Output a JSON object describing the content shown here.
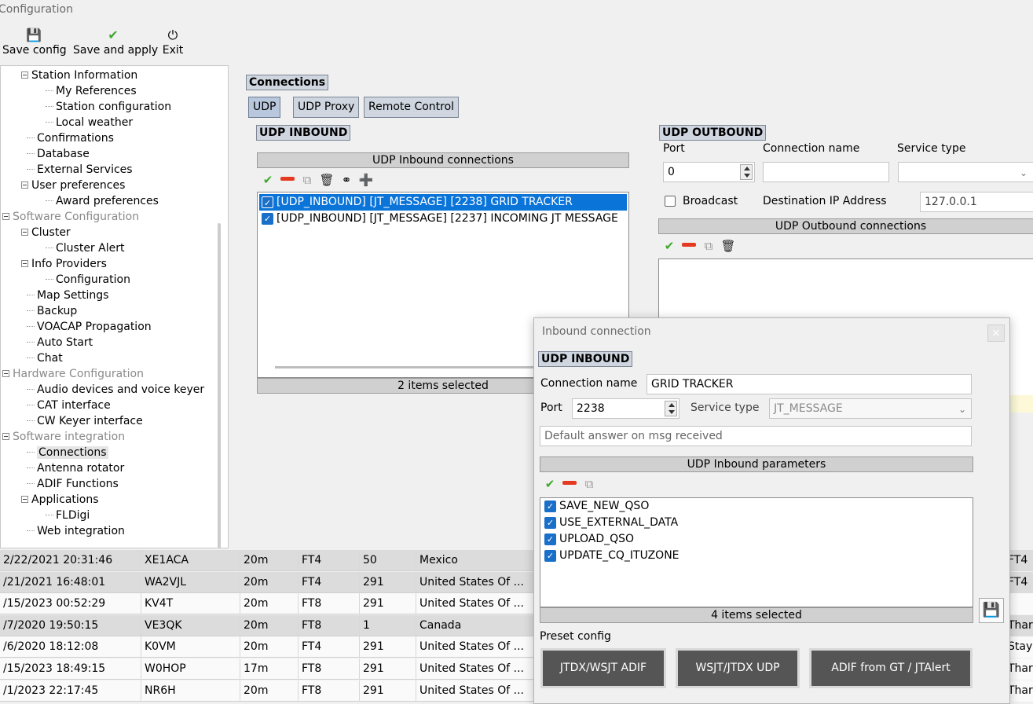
{
  "window": {
    "title": "Configuration"
  },
  "toolbar": {
    "save_config": "Save config",
    "save_and_apply": "Save and apply",
    "exit": "Exit"
  },
  "tree": {
    "station_information": "Station Information",
    "my_references": "My References",
    "station_configuration": "Station configuration",
    "local_weather": "Local weather",
    "confirmations": "Confirmations",
    "database": "Database",
    "external_services": "External Services",
    "user_preferences": "User preferences",
    "award_preferences": "Award preferences",
    "software_configuration": "Software Configuration",
    "cluster": "Cluster",
    "cluster_alert": "Cluster Alert",
    "info_providers": "Info Providers",
    "configuration": "Configuration",
    "map_settings": "Map Settings",
    "backup": "Backup",
    "voacap": "VOACAP Propagation",
    "auto_start": "Auto Start",
    "chat": "Chat",
    "hardware_configuration": "Hardware Configuration",
    "audio_devices": "Audio devices and voice keyer",
    "cat_interface": "CAT interface",
    "cw_keyer": "CW Keyer interface",
    "software_integration": "Software integration",
    "connections": "Connections",
    "antenna_rotator": "Antenna rotator",
    "adif_functions": "ADIF Functions",
    "applications": "Applications",
    "fldigi": "FLDigi",
    "web_integration": "Web integration"
  },
  "main": {
    "section_title": "Connections",
    "tabs": {
      "udp": "UDP",
      "udp_proxy": "UDP Proxy",
      "remote_control": "Remote Control"
    },
    "inbound": {
      "label": "UDP INBOUND",
      "list_header": "UDP Inbound connections",
      "rows": [
        "[UDP_INBOUND] [JT_MESSAGE] [2238] GRID TRACKER",
        "[UDP_INBOUND] [JT_MESSAGE] [2237] INCOMING JT MESSAGE"
      ],
      "footer": "2 items selected"
    },
    "outbound": {
      "label": "UDP OUTBOUND",
      "port_label": "Port",
      "port_value": "0",
      "connection_name_label": "Connection name",
      "service_type_label": "Service type",
      "broadcast_label": "Broadcast",
      "dest_ip_label": "Destination IP Address",
      "dest_ip_value": "127.0.0.1",
      "list_header": "UDP Outbound connections"
    }
  },
  "grid": {
    "rows": [
      {
        "date": "2/22/2021 20:31:46",
        "call": "XE1ACA",
        "band": "20m",
        "mode": "FT4",
        "num": "50",
        "country": "Mexico",
        "right": "FT4"
      },
      {
        "date": "/21/2021 16:48:01",
        "call": "WA2VJL",
        "band": "20m",
        "mode": "FT4",
        "num": "291",
        "country": "United States Of ...",
        "right": "FT4"
      },
      {
        "date": "/15/2023 00:52:29",
        "call": "KV4T",
        "band": "20m",
        "mode": "FT8",
        "num": "291",
        "country": "United States Of ...",
        "right": ""
      },
      {
        "date": "/7/2020 19:50:15",
        "call": "VE3QK",
        "band": "20m",
        "mode": "FT8",
        "num": "1",
        "country": "Canada",
        "right": "Thar"
      },
      {
        "date": "/6/2020 18:12:08",
        "call": "K0VM",
        "band": "20m",
        "mode": "FT4",
        "num": "291",
        "country": "United States Of ...",
        "right": "Stay"
      },
      {
        "date": "/15/2023 18:49:15",
        "call": "W0HOP",
        "band": "17m",
        "mode": "FT8",
        "num": "291",
        "country": "United States Of ...",
        "right": "Thar"
      },
      {
        "date": "/1/2023 22:17:45",
        "call": "NR6H",
        "band": "20m",
        "mode": "FT8",
        "num": "291",
        "country": "United States Of ...",
        "right": "Thar"
      }
    ]
  },
  "dialog": {
    "title": "Inbound connection",
    "close": "×",
    "section_label": "UDP INBOUND",
    "connection_name_label": "Connection name",
    "connection_name_value": "GRID TRACKER",
    "port_label": "Port",
    "port_value": "2238",
    "service_type_label": "Service type",
    "service_type_value": "JT_MESSAGE",
    "default_answer_placeholder": "Default answer on msg received",
    "params_header": "UDP Inbound parameters",
    "params": [
      "SAVE_NEW_QSO",
      "USE_EXTERNAL_DATA",
      "UPLOAD_QSO",
      "UPDATE_CQ_ITUZONE"
    ],
    "params_footer": "4 items selected",
    "preset_label": "Preset config",
    "presets": [
      "JTDX/WSJT ADIF",
      "WSJT/JTDX UDP",
      "ADIF from GT / JTAlert"
    ]
  }
}
